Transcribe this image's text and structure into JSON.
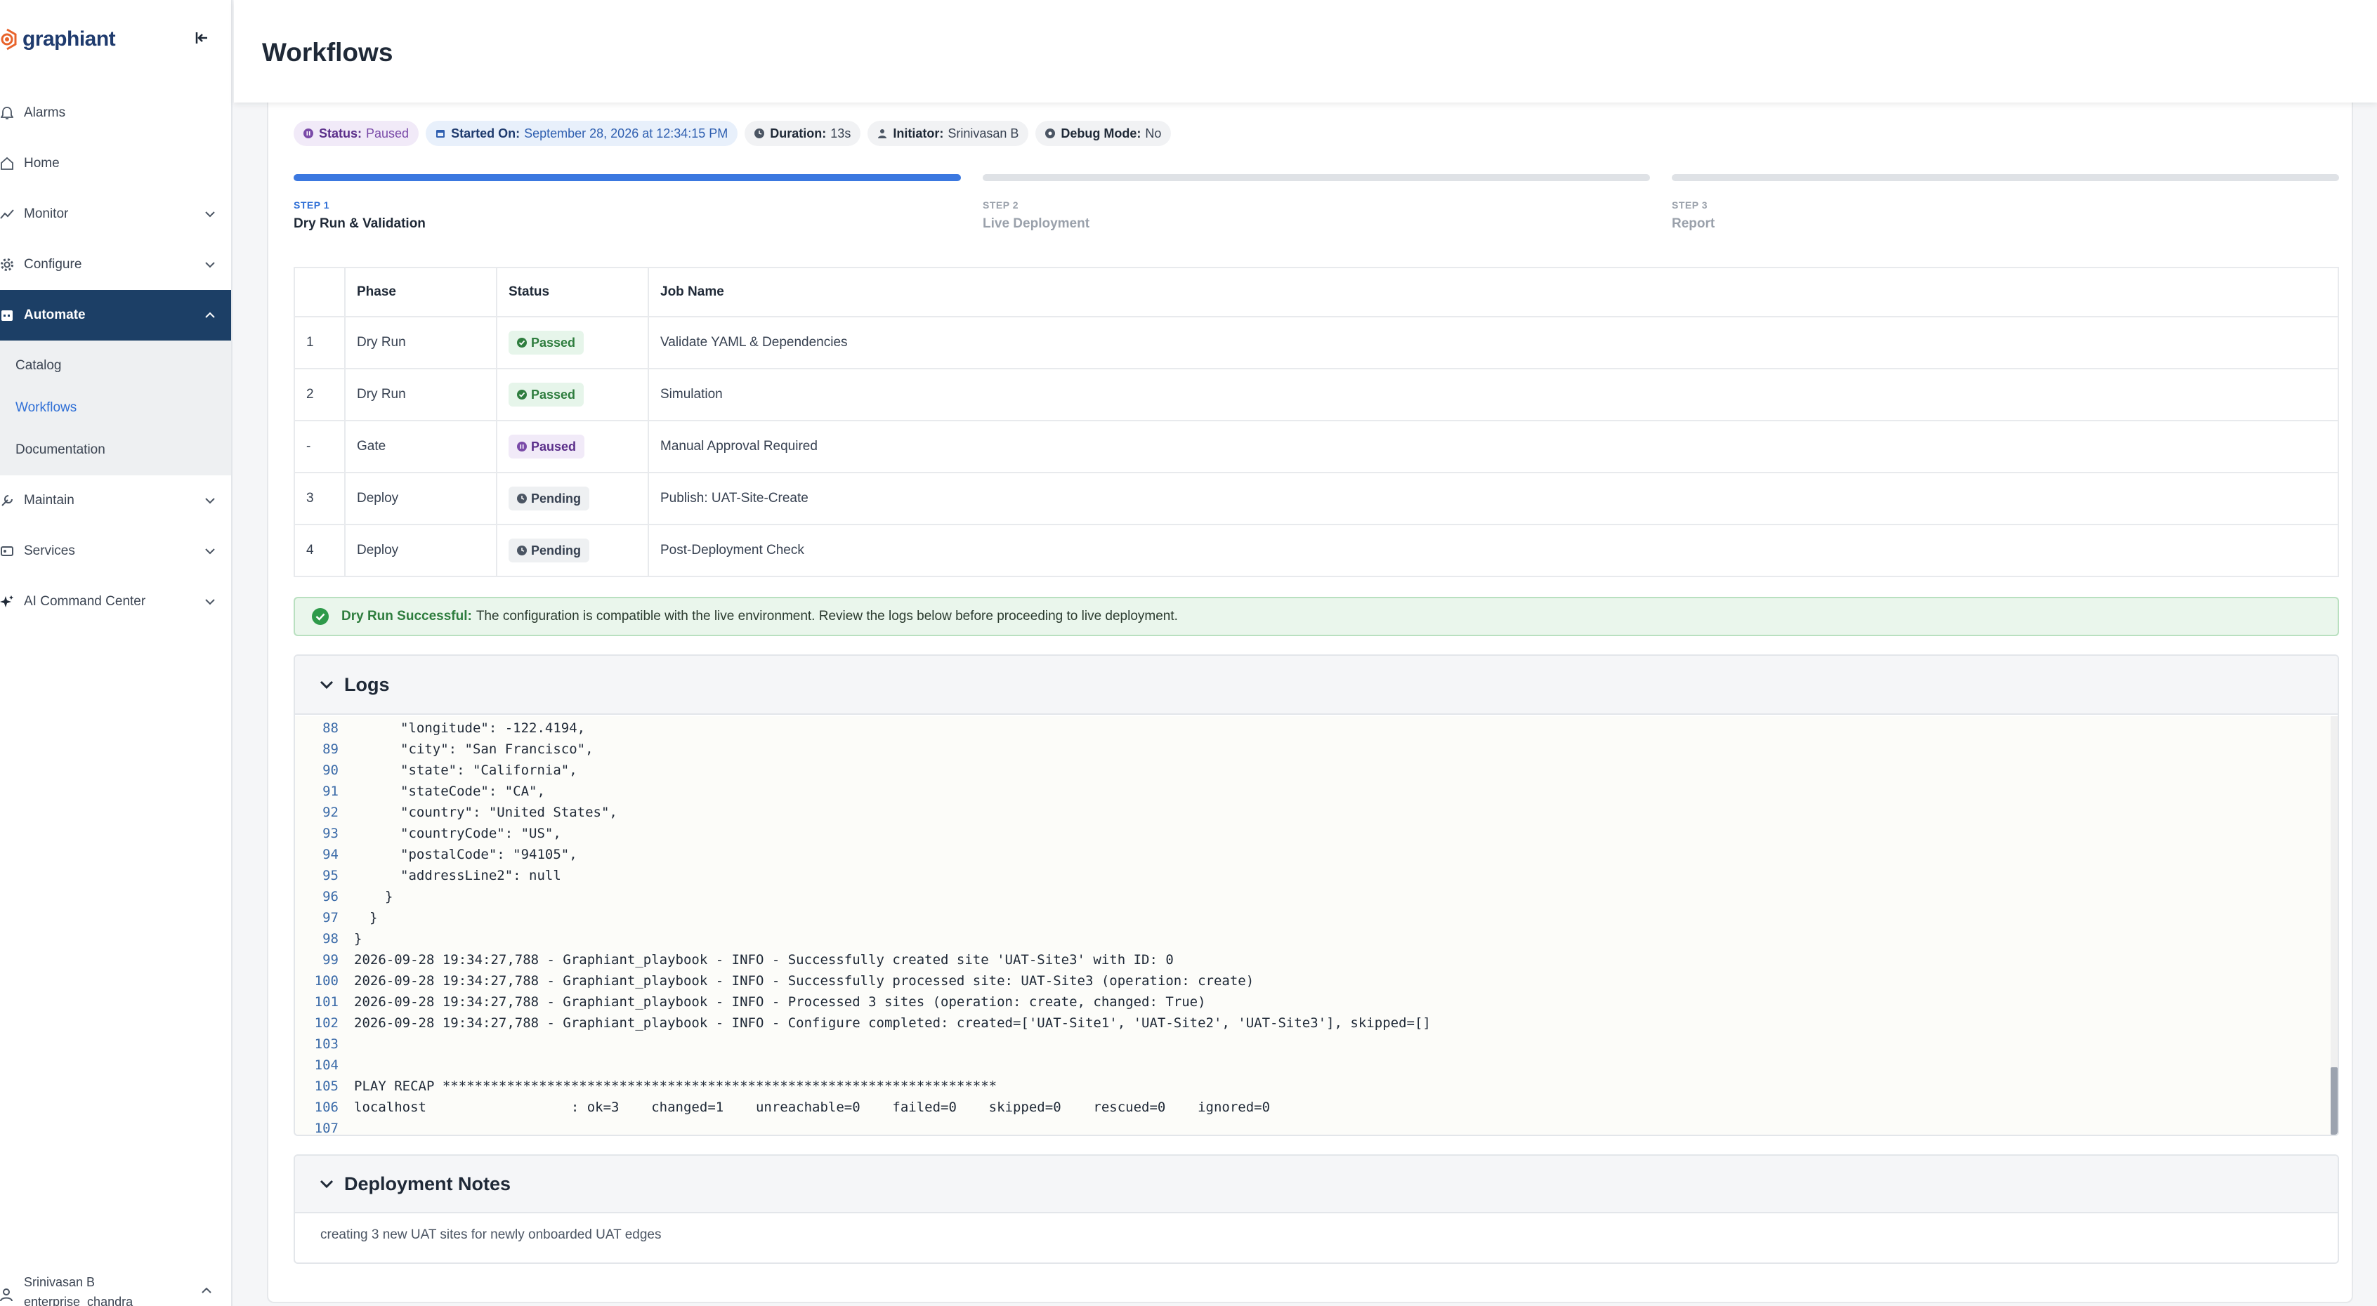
{
  "app": {
    "brand": "graphiant",
    "page_title": "Workflows"
  },
  "sidebar": {
    "items": [
      {
        "key": "alarms",
        "label": "Alarms",
        "icon": "bell-icon"
      },
      {
        "key": "home",
        "label": "Home",
        "icon": "home-icon"
      },
      {
        "key": "monitor",
        "label": "Monitor",
        "icon": "chart-icon"
      },
      {
        "key": "configure",
        "label": "Configure",
        "icon": "gear-icon"
      },
      {
        "key": "automate",
        "label": "Automate",
        "icon": "calendar-icon"
      },
      {
        "key": "maintain",
        "label": "Maintain",
        "icon": "wrench-icon"
      },
      {
        "key": "services",
        "label": "Services",
        "icon": "services-icon"
      },
      {
        "key": "ai",
        "label": "AI Command Center",
        "icon": "sparkle-icon"
      }
    ],
    "automate_sub": [
      {
        "label": "Catalog"
      },
      {
        "label": "Workflows"
      },
      {
        "label": "Documentation"
      }
    ],
    "user": {
      "name": "Srinivasan B",
      "org": "enterprise_chandra"
    }
  },
  "status_chips": {
    "status_label": "Status:",
    "status_value": "Paused",
    "started_label": "Started On:",
    "started_value": "September 28, 2026 at 12:34:15 PM",
    "duration_label": "Duration:",
    "duration_value": "13s",
    "initiator_label": "Initiator:",
    "initiator_value": "Srinivasan B",
    "debug_label": "Debug Mode:",
    "debug_value": "No"
  },
  "steps": [
    {
      "num": "STEP 1",
      "name": "Dry Run & Validation",
      "active": true
    },
    {
      "num": "STEP 2",
      "name": "Live Deployment",
      "active": false
    },
    {
      "num": "STEP 3",
      "name": "Report",
      "active": false
    }
  ],
  "jobs": {
    "headers": [
      "",
      "Phase",
      "Status",
      "Job Name"
    ],
    "rows": [
      {
        "idx": "1",
        "phase": "Dry Run",
        "status": "Passed",
        "job": "Validate YAML & Dependencies"
      },
      {
        "idx": "2",
        "phase": "Dry Run",
        "status": "Passed",
        "job": "Simulation"
      },
      {
        "idx": "-",
        "phase": "Gate",
        "status": "Paused",
        "job": "Manual Approval Required"
      },
      {
        "idx": "3",
        "phase": "Deploy",
        "status": "Pending",
        "job": "Publish: UAT-Site-Create"
      },
      {
        "idx": "4",
        "phase": "Deploy",
        "status": "Pending",
        "job": "Post-Deployment Check"
      }
    ]
  },
  "alert": {
    "title": "Dry Run Successful:",
    "text": "The configuration is compatible with the live environment. Review the logs below before proceeding to live deployment."
  },
  "logs": {
    "title": "Logs",
    "lines": [
      {
        "n": "88",
        "indent": 3,
        "t": "\"longitude\": -122.4194,"
      },
      {
        "n": "89",
        "indent": 3,
        "t": "\"city\": \"San Francisco\","
      },
      {
        "n": "90",
        "indent": 3,
        "t": "\"state\": \"California\","
      },
      {
        "n": "91",
        "indent": 3,
        "t": "\"stateCode\": \"CA\","
      },
      {
        "n": "92",
        "indent": 3,
        "t": "\"country\": \"United States\","
      },
      {
        "n": "93",
        "indent": 3,
        "t": "\"countryCode\": \"US\","
      },
      {
        "n": "94",
        "indent": 3,
        "t": "\"postalCode\": \"94105\","
      },
      {
        "n": "95",
        "indent": 3,
        "t": "\"addressLine2\": null"
      },
      {
        "n": "96",
        "indent": 2,
        "t": "}"
      },
      {
        "n": "97",
        "indent": 1,
        "t": "}"
      },
      {
        "n": "98",
        "indent": 0,
        "t": "}"
      },
      {
        "n": "99",
        "indent": 0,
        "t": "2026-09-28 19:34:27,788 - Graphiant_playbook - INFO - Successfully created site 'UAT-Site3' with ID: 0"
      },
      {
        "n": "100",
        "indent": 0,
        "t": "2026-09-28 19:34:27,788 - Graphiant_playbook - INFO - Successfully processed site: UAT-Site3 (operation: create)"
      },
      {
        "n": "101",
        "indent": 0,
        "t": "2026-09-28 19:34:27,788 - Graphiant_playbook - INFO - Processed 3 sites (operation: create, changed: True)"
      },
      {
        "n": "102",
        "indent": 0,
        "t": "2026-09-28 19:34:27,788 - Graphiant_playbook - INFO - Configure completed: created=['UAT-Site1', 'UAT-Site2', 'UAT-Site3'], skipped=[]"
      },
      {
        "n": "103",
        "indent": 0,
        "t": ""
      },
      {
        "n": "104",
        "indent": 0,
        "t": ""
      },
      {
        "n": "105",
        "indent": 0,
        "t": "PLAY RECAP *********************************************************************"
      },
      {
        "n": "106",
        "indent": 0,
        "t": "localhost                  : ok=3    changed=1    unreachable=0    failed=0    skipped=0    rescued=0    ignored=0"
      },
      {
        "n": "107",
        "indent": 0,
        "t": ""
      }
    ]
  },
  "notes": {
    "title": "Deployment Notes",
    "text": "creating 3 new UAT sites for newly onboarded UAT edges"
  },
  "colors": {
    "primary": "#1c3f66",
    "accent": "#3b78e0",
    "success": "#2e7d3e",
    "paused": "#7a4aa8"
  }
}
